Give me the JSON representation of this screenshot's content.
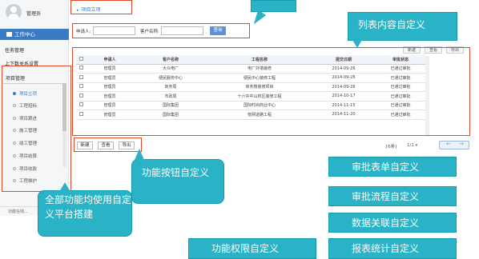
{
  "sidebar": {
    "user_name": "管理员",
    "work_center": "工作中心",
    "task_mgmt": "任务管理",
    "subtask_mgmt": "上下数关系设置",
    "project_mgmt": "项目管理",
    "items": [
      {
        "label": "项目立项",
        "active": true
      },
      {
        "label": "工程招标",
        "active": false
      },
      {
        "label": "项目跟进",
        "active": false
      },
      {
        "label": "施工管理",
        "active": false
      },
      {
        "label": "竣工管理",
        "active": false
      },
      {
        "label": "项目结算",
        "active": false
      },
      {
        "label": "项目收款",
        "active": false
      },
      {
        "label": "工程维护",
        "active": false
      }
    ],
    "bottom_text": "功能在线..."
  },
  "breadcrumb": "项目立项",
  "search": {
    "applicant_label": "申请人:",
    "client_label": "客户名称:",
    "button": "查询"
  },
  "toolbar": {
    "new": "新建",
    "view": "查看",
    "export": "导出"
  },
  "table": {
    "headers": [
      "申请人",
      "客户名称",
      "工程名称",
      "提交日期",
      "审批状态"
    ],
    "rows": [
      [
        "管理员",
        "大众电厂",
        "电厂外墙装修",
        "2014-09-26",
        "已通过审批"
      ],
      [
        "管理员",
        "便民服务中心",
        "便民中心装修工程",
        "2014-09-26",
        "已通过审批"
      ],
      [
        "管理员",
        "商务局",
        "商务楼装修项目",
        "2014-09-26",
        "已通过审批"
      ],
      [
        "管理员",
        "市政局",
        "十六中中山校区装修工程",
        "2014-10-17",
        "已通过审批"
      ],
      [
        "管理员",
        "国际集团",
        "国际时尚商业中心",
        "2014-11-15",
        "已通过审批"
      ],
      [
        "管理员",
        "国际集团",
        "管网道路工程",
        "2014-11-20",
        "已通过审批"
      ]
    ]
  },
  "bottom_buttons": {
    "new": "新建",
    "view": "查看",
    "export": "导出"
  },
  "pager": {
    "count": "[6条]",
    "page": "1/1"
  },
  "callouts": {
    "list_custom": "列表内容自定义",
    "button_custom": "功能按钮自定义",
    "platform": "全部功能均使用自定义平台搭建",
    "form_custom": "审批表单自定义",
    "flow_custom": "审批流程自定义",
    "data_custom": "数据关联自定义",
    "perm_custom": "功能权限自定义",
    "report_custom": "报表统计自定义"
  },
  "colors": {
    "accent": "#3a7bc8",
    "callout": "#2ab3c6",
    "frame": "#e04a2a"
  }
}
